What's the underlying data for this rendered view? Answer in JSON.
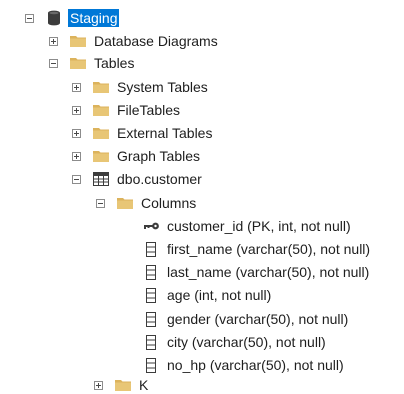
{
  "tree": {
    "root": {
      "label": "Staging",
      "icon": "database-icon",
      "expanded": true,
      "selected": true
    },
    "database_diagrams": {
      "label": "Database Diagrams",
      "icon": "folder-icon",
      "expanded": false
    },
    "tables": {
      "label": "Tables",
      "icon": "folder-icon",
      "expanded": true
    },
    "system_tables": {
      "label": "System Tables",
      "icon": "folder-icon",
      "expanded": false
    },
    "file_tables": {
      "label": "FileTables",
      "icon": "folder-icon",
      "expanded": false
    },
    "external_tables": {
      "label": "External Tables",
      "icon": "folder-icon",
      "expanded": false
    },
    "graph_tables": {
      "label": "Graph Tables",
      "icon": "folder-icon",
      "expanded": false
    },
    "customer_table": {
      "label": "dbo.customer",
      "icon": "table-icon",
      "expanded": true
    },
    "columns_folder": {
      "label": "Columns",
      "icon": "folder-icon",
      "expanded": true
    },
    "columns": [
      {
        "label": "customer_id (PK, int, not null)",
        "icon": "primary-key-icon"
      },
      {
        "label": "first_name (varchar(50), not null)",
        "icon": "column-icon"
      },
      {
        "label": "last_name (varchar(50), not null)",
        "icon": "column-icon"
      },
      {
        "label": "age (int, not null)",
        "icon": "column-icon"
      },
      {
        "label": "gender (varchar(50), not null)",
        "icon": "column-icon"
      },
      {
        "label": "city (varchar(50), not null)",
        "icon": "column-icon"
      },
      {
        "label": "no_hp (varchar(50), not null)",
        "icon": "column-icon"
      }
    ],
    "keys_folder_partial": {
      "label": "K",
      "icon": "folder-icon",
      "expanded": false
    }
  },
  "colors": {
    "selection": "#0078d7",
    "folder": "#dcb35c",
    "database": "#3c3c3c",
    "text": "#1e1e1e"
  }
}
